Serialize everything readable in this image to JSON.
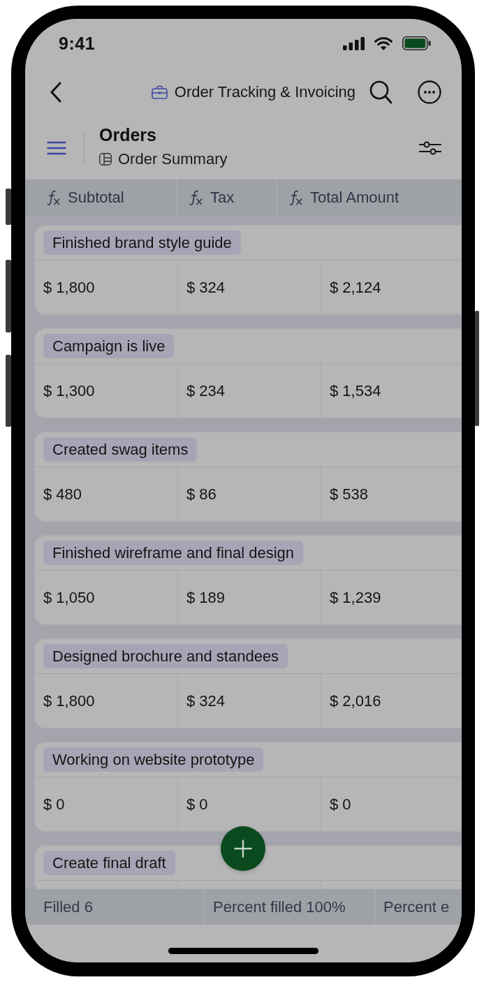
{
  "status_bar": {
    "time": "9:41"
  },
  "nav_bar": {
    "title": "Order Tracking & Invoicing"
  },
  "view_header": {
    "title": "Orders",
    "subtitle": "Order Summary"
  },
  "table": {
    "columns": [
      {
        "label": "Subtotal"
      },
      {
        "label": "Tax"
      },
      {
        "label": "Total Amount"
      }
    ],
    "rows": [
      {
        "title": "Finished brand style guide",
        "values": [
          "$ 1,800",
          "$ 324",
          "$ 2,124"
        ]
      },
      {
        "title": "Campaign is live",
        "values": [
          "$ 1,300",
          "$ 234",
          "$ 1,534"
        ]
      },
      {
        "title": "Created swag items",
        "values": [
          "$ 480",
          "$ 86",
          "$ 538"
        ]
      },
      {
        "title": "Finished wireframe and final design",
        "values": [
          "$ 1,050",
          "$ 189",
          "$ 1,239"
        ]
      },
      {
        "title": "Designed brochure and standees",
        "values": [
          "$ 1,800",
          "$ 324",
          "$ 2,016"
        ]
      },
      {
        "title": "Working on website prototype",
        "values": [
          "$ 0",
          "$ 0",
          "$ 0"
        ]
      },
      {
        "title": "Create final draft"
      }
    ]
  },
  "summary_bar": [
    {
      "text": "Filled 6"
    },
    {
      "text": "Percent filled 100%"
    },
    {
      "text": "Percent e"
    }
  ]
}
